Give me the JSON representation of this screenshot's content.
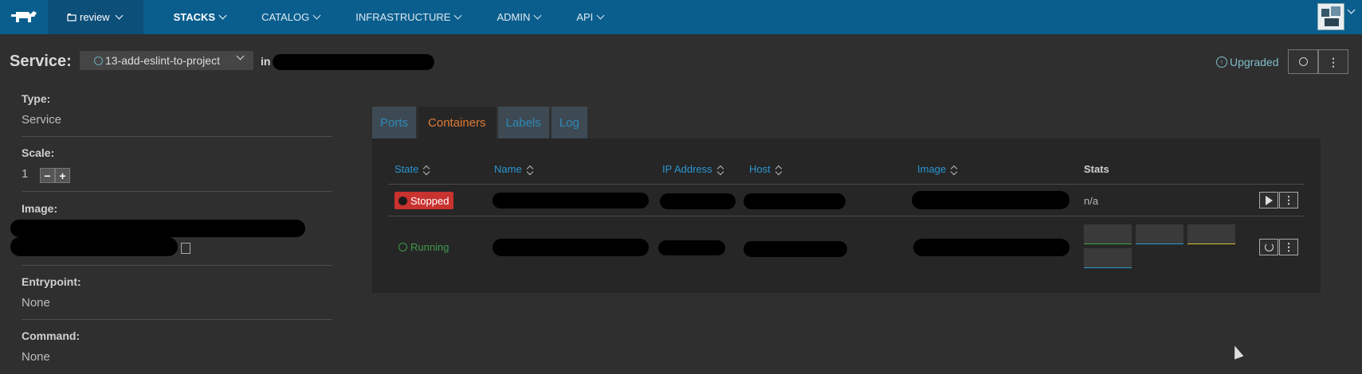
{
  "topbar": {
    "env_label": "review",
    "nav": [
      "STACKS",
      "CATALOG",
      "INFRASTRUCTURE",
      "ADMIN",
      "API"
    ]
  },
  "header": {
    "title": "Service:",
    "service_name": "13-add-eslint-to-project",
    "in_label": "in",
    "state_label": "Upgraded"
  },
  "info": {
    "type_label": "Type:",
    "type_value": "Service",
    "scale_label": "Scale:",
    "scale_value": "1",
    "image_label": "Image:",
    "entrypoint_label": "Entrypoint:",
    "entrypoint_value": "None",
    "command_label": "Command:",
    "command_value": "None"
  },
  "tabs": [
    "Ports",
    "Containers",
    "Labels",
    "Log"
  ],
  "table": {
    "headers": [
      "State",
      "Name",
      "IP Address",
      "Host",
      "Image",
      "Stats"
    ],
    "rows": [
      {
        "state": "Stopped",
        "stats": "n/a"
      },
      {
        "state": "Running",
        "stats": ""
      }
    ]
  },
  "colors": {
    "nav_bg": "#0a5e8e",
    "accent": "#2a95d0",
    "active_tab": "#e07a35",
    "stopped": "#c8322f",
    "running": "#3f9b4a",
    "upgraded": "#7fbcc9",
    "stat_lines": [
      "#3f9b4a",
      "#2a95d0",
      "#d6c13a",
      "#2a95d0"
    ]
  }
}
